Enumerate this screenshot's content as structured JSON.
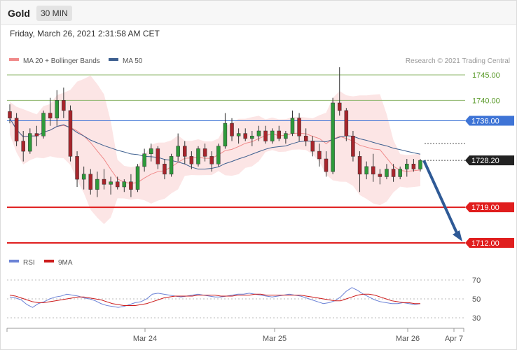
{
  "header": {
    "symbol": "Gold",
    "interval": "30 MIN",
    "datetime": "Friday, March 26, 2021 2:31:58 AM CET"
  },
  "legend": {
    "ma20_label": "MA 20 + Bollinger Bands",
    "ma50_label": "MA 50",
    "credit": "Research © 2021 Trading Central",
    "ma20_color": "#f08a8a",
    "ma50_color": "#3d5f8f"
  },
  "rsi_legend": {
    "rsi_label": "RSI",
    "ma9_label": "9MA",
    "rsi_color": "#6b82d6",
    "ma9_color": "#cc1a1a"
  },
  "chart_data": {
    "type": "candlestick",
    "title": "Gold",
    "interval": "30 MIN",
    "ylim": [
      1705,
      1749
    ],
    "levels": [
      {
        "value": 1745.0,
        "label": "1745.00",
        "color": "#8cb56a",
        "kind": "resistance"
      },
      {
        "value": 1740.0,
        "label": "1740.00",
        "color": "#8cb56a",
        "kind": "resistance"
      },
      {
        "value": 1736.0,
        "label": "1736.00",
        "color": "#3e74d6",
        "kind": "pivot"
      },
      {
        "value": 1728.2,
        "label": "1728.20",
        "color": "#222222",
        "kind": "last"
      },
      {
        "value": 1719.0,
        "label": "1719.00",
        "color": "#e01e1e",
        "kind": "support"
      },
      {
        "value": 1712.0,
        "label": "1712.00",
        "color": "#e01e1e",
        "kind": "support"
      }
    ],
    "x_ticks": [
      "Mar 24",
      "Mar 25",
      "Mar 26",
      "Apr 7"
    ],
    "arrow": {
      "from": 1728.2,
      "to": 1712.0,
      "color": "#2f5a96"
    },
    "rsi": {
      "ticks": [
        70,
        50,
        30
      ],
      "ylim": [
        20,
        78
      ],
      "rsi_values": [
        52,
        51,
        49,
        44,
        41,
        45,
        47,
        50,
        52,
        53,
        55,
        54,
        53,
        51,
        50,
        48,
        45,
        43,
        42,
        41,
        42,
        44,
        46,
        47,
        50,
        55,
        56,
        55,
        54,
        53,
        52,
        53,
        54,
        55,
        54,
        53,
        52,
        52,
        53,
        54,
        55,
        55,
        56,
        55,
        54,
        53,
        52,
        53,
        54,
        55,
        54,
        53,
        51,
        49,
        47,
        45,
        46,
        48,
        52,
        58,
        62,
        59,
        55,
        52,
        49,
        47,
        46,
        45,
        45,
        46,
        45,
        44,
        45
      ],
      "ma_values": [
        54,
        53,
        51,
        49,
        47,
        46,
        46,
        47,
        48,
        49,
        50,
        51,
        52,
        52,
        51,
        50,
        49,
        47,
        45,
        44,
        43,
        43,
        43,
        44,
        45,
        47,
        49,
        51,
        52,
        53,
        53,
        53,
        53,
        54,
        54,
        54,
        54,
        53,
        53,
        53,
        54,
        54,
        54,
        55,
        55,
        54,
        54,
        54,
        54,
        54,
        54,
        54,
        53,
        52,
        51,
        50,
        49,
        48,
        48,
        50,
        52,
        54,
        55,
        55,
        54,
        52,
        50,
        48,
        47,
        46,
        46,
        45,
        45
      ]
    },
    "candles": [
      [
        1737.8,
        1739.2,
        1735.5,
        1736.5
      ],
      [
        1736.5,
        1737.5,
        1731.0,
        1732.0
      ],
      [
        1732.0,
        1734.0,
        1728.0,
        1730.0
      ],
      [
        1730.0,
        1734.5,
        1729.5,
        1733.5
      ],
      [
        1733.5,
        1735.0,
        1731.0,
        1733.0
      ],
      [
        1733.0,
        1738.0,
        1732.5,
        1737.5
      ],
      [
        1737.5,
        1740.5,
        1735.0,
        1736.5
      ],
      [
        1736.5,
        1742.0,
        1735.0,
        1740.0
      ],
      [
        1740.0,
        1742.5,
        1736.5,
        1738.0
      ],
      [
        1738.0,
        1739.0,
        1728.0,
        1729.0
      ],
      [
        1729.0,
        1730.0,
        1723.0,
        1724.5
      ],
      [
        1724.5,
        1727.0,
        1722.5,
        1725.5
      ],
      [
        1725.5,
        1726.5,
        1721.5,
        1722.5
      ],
      [
        1722.5,
        1726.0,
        1721.0,
        1724.5
      ],
      [
        1724.5,
        1726.5,
        1722.5,
        1723.5
      ],
      [
        1723.5,
        1725.0,
        1721.5,
        1724.0
      ],
      [
        1724.0,
        1725.0,
        1722.5,
        1723.0
      ],
      [
        1723.0,
        1724.5,
        1722.0,
        1724.0
      ],
      [
        1724.0,
        1725.5,
        1721.0,
        1722.5
      ],
      [
        1722.5,
        1727.5,
        1722.0,
        1727.0
      ],
      [
        1727.0,
        1730.5,
        1726.0,
        1729.5
      ],
      [
        1729.5,
        1731.5,
        1728.0,
        1730.5
      ],
      [
        1730.5,
        1731.0,
        1726.5,
        1727.5
      ],
      [
        1727.5,
        1728.5,
        1724.5,
        1725.5
      ],
      [
        1725.5,
        1729.5,
        1725.0,
        1729.0
      ],
      [
        1729.0,
        1733.5,
        1728.0,
        1731.0
      ],
      [
        1731.0,
        1732.0,
        1727.5,
        1729.0
      ],
      [
        1729.0,
        1730.0,
        1726.5,
        1727.5
      ],
      [
        1727.5,
        1731.0,
        1727.0,
        1730.5
      ],
      [
        1730.5,
        1731.5,
        1728.0,
        1729.0
      ],
      [
        1729.0,
        1730.0,
        1726.0,
        1727.5
      ],
      [
        1727.5,
        1731.5,
        1727.0,
        1731.0
      ],
      [
        1731.0,
        1737.5,
        1730.5,
        1735.5
      ],
      [
        1735.5,
        1736.5,
        1732.0,
        1733.0
      ],
      [
        1733.0,
        1734.5,
        1731.5,
        1733.5
      ],
      [
        1733.5,
        1734.5,
        1732.0,
        1732.5
      ],
      [
        1732.5,
        1734.0,
        1731.0,
        1733.0
      ],
      [
        1733.0,
        1735.0,
        1732.0,
        1734.0
      ],
      [
        1734.0,
        1735.0,
        1731.5,
        1732.0
      ],
      [
        1732.0,
        1734.5,
        1731.5,
        1734.0
      ],
      [
        1734.0,
        1735.0,
        1732.0,
        1732.5
      ],
      [
        1732.5,
        1734.0,
        1731.5,
        1733.5
      ],
      [
        1733.5,
        1738.0,
        1733.0,
        1736.5
      ],
      [
        1736.5,
        1737.5,
        1732.0,
        1733.0
      ],
      [
        1733.0,
        1734.5,
        1731.0,
        1732.0
      ],
      [
        1732.0,
        1733.0,
        1729.0,
        1730.0
      ],
      [
        1730.0,
        1731.5,
        1727.0,
        1728.5
      ],
      [
        1728.5,
        1730.0,
        1725.0,
        1726.0
      ],
      [
        1726.0,
        1740.5,
        1725.5,
        1739.5
      ],
      [
        1739.5,
        1746.5,
        1737.0,
        1738.0
      ],
      [
        1738.0,
        1738.5,
        1732.0,
        1733.0
      ],
      [
        1733.0,
        1734.0,
        1728.0,
        1729.0
      ],
      [
        1729.0,
        1730.0,
        1722.0,
        1725.5
      ],
      [
        1725.5,
        1728.0,
        1724.5,
        1727.0
      ],
      [
        1727.0,
        1729.5,
        1724.0,
        1725.5
      ],
      [
        1725.5,
        1726.5,
        1723.5,
        1725.0
      ],
      [
        1725.0,
        1727.5,
        1724.5,
        1726.5
      ],
      [
        1726.5,
        1727.5,
        1724.0,
        1725.0
      ],
      [
        1725.0,
        1727.0,
        1724.5,
        1726.5
      ],
      [
        1726.5,
        1728.5,
        1725.0,
        1727.5
      ],
      [
        1727.5,
        1728.5,
        1726.0,
        1726.5
      ],
      [
        1726.5,
        1728.5,
        1726.0,
        1728.2
      ]
    ]
  }
}
